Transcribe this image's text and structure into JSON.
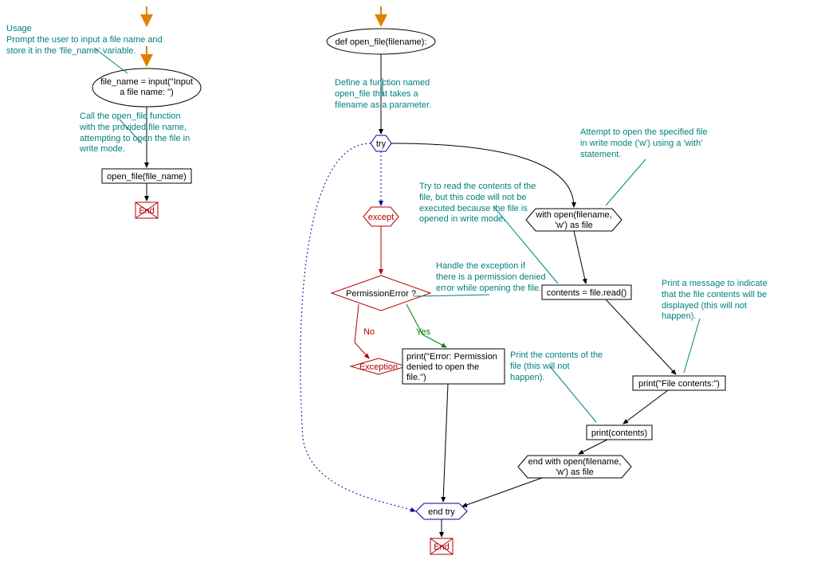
{
  "chart_data": {
    "type": "flowchart",
    "subcharts": [
      {
        "name": "main",
        "nodes": [
          {
            "id": "m_start",
            "type": "start",
            "label": ""
          },
          {
            "id": "m_input",
            "type": "process-ellipse",
            "label": "file_name = input(\"Input a file name: \")"
          },
          {
            "id": "m_call",
            "type": "process-rect",
            "label": "open_file(file_name)"
          },
          {
            "id": "m_end",
            "type": "end",
            "label": "End"
          }
        ],
        "edges": [
          {
            "from": "m_start",
            "to": "m_input"
          },
          {
            "from": "m_input",
            "to": "m_call"
          },
          {
            "from": "m_call",
            "to": "m_end"
          }
        ]
      },
      {
        "name": "open_file",
        "nodes": [
          {
            "id": "f_start",
            "type": "start",
            "label": ""
          },
          {
            "id": "f_def",
            "type": "process-ellipse",
            "label": "def open_file(filename):"
          },
          {
            "id": "f_try",
            "type": "try",
            "label": "try"
          },
          {
            "id": "f_except",
            "type": "except",
            "label": "except"
          },
          {
            "id": "f_perm",
            "type": "decision",
            "label": "PermissionError ?"
          },
          {
            "id": "f_exc",
            "type": "exception",
            "label": "Exception"
          },
          {
            "id": "f_print_err",
            "type": "process-rect",
            "label": "print(\"Error: Permission denied to open the file.\")"
          },
          {
            "id": "f_with",
            "type": "with-open",
            "label": "with open(filename, 'w') as file"
          },
          {
            "id": "f_read",
            "type": "process-rect",
            "label": "contents = file.read()"
          },
          {
            "id": "f_print_hdr",
            "type": "process-rect",
            "label": "print(\"File contents:\")"
          },
          {
            "id": "f_print_cont",
            "type": "process-rect",
            "label": "print(contents)"
          },
          {
            "id": "f_endwith",
            "type": "with-close",
            "label": "end with open(filename, 'w') as file"
          },
          {
            "id": "f_endtry",
            "type": "end-try",
            "label": "end try"
          },
          {
            "id": "f_end",
            "type": "end",
            "label": "End"
          }
        ],
        "edges": [
          {
            "from": "f_start",
            "to": "f_def"
          },
          {
            "from": "f_def",
            "to": "f_try"
          },
          {
            "from": "f_try",
            "to": "f_with",
            "label": ""
          },
          {
            "from": "f_try",
            "to": "f_except",
            "style": "dashed"
          },
          {
            "from": "f_except",
            "to": "f_perm"
          },
          {
            "from": "f_perm",
            "to": "f_print_err",
            "label": "Yes"
          },
          {
            "from": "f_perm",
            "to": "f_exc",
            "label": "No"
          },
          {
            "from": "f_with",
            "to": "f_read"
          },
          {
            "from": "f_read",
            "to": "f_print_hdr"
          },
          {
            "from": "f_print_hdr",
            "to": "f_print_cont"
          },
          {
            "from": "f_print_cont",
            "to": "f_endwith"
          },
          {
            "from": "f_endwith",
            "to": "f_endtry"
          },
          {
            "from": "f_print_err",
            "to": "f_endtry"
          },
          {
            "from": "f_try",
            "to": "f_endtry",
            "style": "dashed-left"
          },
          {
            "from": "f_endtry",
            "to": "f_end"
          }
        ]
      }
    ]
  },
  "annotations": {
    "a1_title": "Usage",
    "a1": "Prompt the user to input a file name and store it in the 'file_name' variable.",
    "a2": "Call the open_file function with the provided file name, attempting to open the file in write mode.",
    "a3": "Define a function named open_file that takes a filename as a parameter.",
    "a4": "Attempt to open the specified file in write mode ('w') using a 'with' statement.",
    "a5": "Try to read the contents of the file, but this code will not be executed because the file is opened in write mode.",
    "a6": "Handle the exception if there is a permission denied error while opening the file.",
    "a7": "Print a message to indicate that the file contents will be displayed (this will not happen).",
    "a8": "Print the contents of the file (this will not happen)."
  },
  "labels": {
    "input_l1": "file_name = input(\"Input",
    "input_l2": "a file name: \")",
    "call": "open_file(file_name)",
    "end": "End",
    "def": "def open_file(filename):",
    "try": "try",
    "except": "except",
    "perm": "PermissionError ?",
    "exception": "Exception",
    "err_l1": "print(\"Error: Permission",
    "err_l2": "denied to open the",
    "err_l3": "file.\")",
    "with_l1": "with open(filename,",
    "with_l2": "'w') as file",
    "read": "contents = file.read()",
    "hdr": "print(\"File contents:\")",
    "cont": "print(contents)",
    "endwith_l1": "end with open(filename,",
    "endwith_l2": "'w') as file",
    "endtry": "end try",
    "yes": "Yes",
    "no": "No"
  }
}
